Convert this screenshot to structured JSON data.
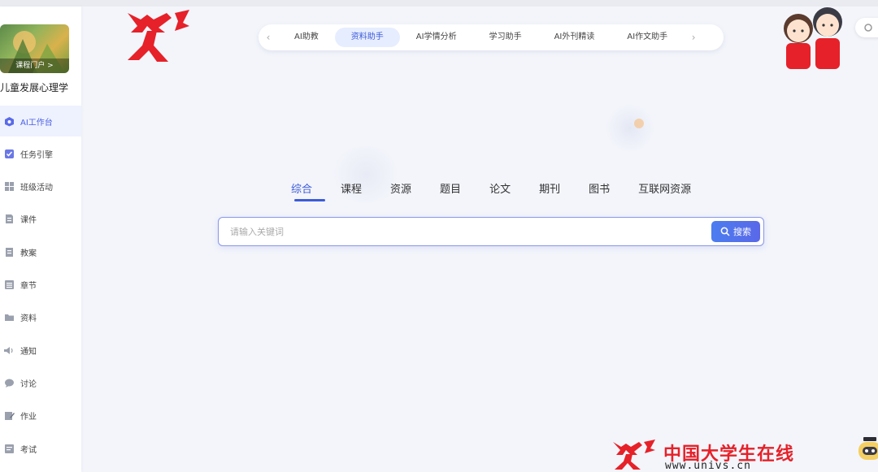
{
  "sidebar": {
    "portal_label": "课程门户 >",
    "course_title": "儿童发展心理学",
    "items": [
      {
        "label": "AI工作台",
        "icon": "robot-icon",
        "active": true
      },
      {
        "label": "任务引擎",
        "icon": "task-icon"
      },
      {
        "label": "班级活动",
        "icon": "grid-icon"
      },
      {
        "label": "课件",
        "icon": "file-icon"
      },
      {
        "label": "教案",
        "icon": "doc-icon"
      },
      {
        "label": "章节",
        "icon": "list-icon"
      },
      {
        "label": "资料",
        "icon": "folder-icon"
      },
      {
        "label": "通知",
        "icon": "speaker-icon"
      },
      {
        "label": "讨论",
        "icon": "chat-icon"
      },
      {
        "label": "作业",
        "icon": "edit-icon"
      },
      {
        "label": "考试",
        "icon": "exam-icon"
      }
    ]
  },
  "ai_tabs": {
    "items": [
      "AI助教",
      "资料助手",
      "AI学情分析",
      "学习助手",
      "AI外刊精读",
      "AI作文助手"
    ],
    "active": "资料助手"
  },
  "search": {
    "categories": [
      "综合",
      "课程",
      "资源",
      "题目",
      "论文",
      "期刊",
      "图书",
      "互联网资源"
    ],
    "active_category": "综合",
    "placeholder": "请输入关键词",
    "value": "",
    "button_label": "搜索"
  },
  "watermark": {
    "name": "中国大学生在线",
    "url": "www.univs.cn"
  },
  "colors": {
    "accent": "#3d5bd9",
    "brand_red": "#e62129",
    "background": "#f3f5fb"
  }
}
